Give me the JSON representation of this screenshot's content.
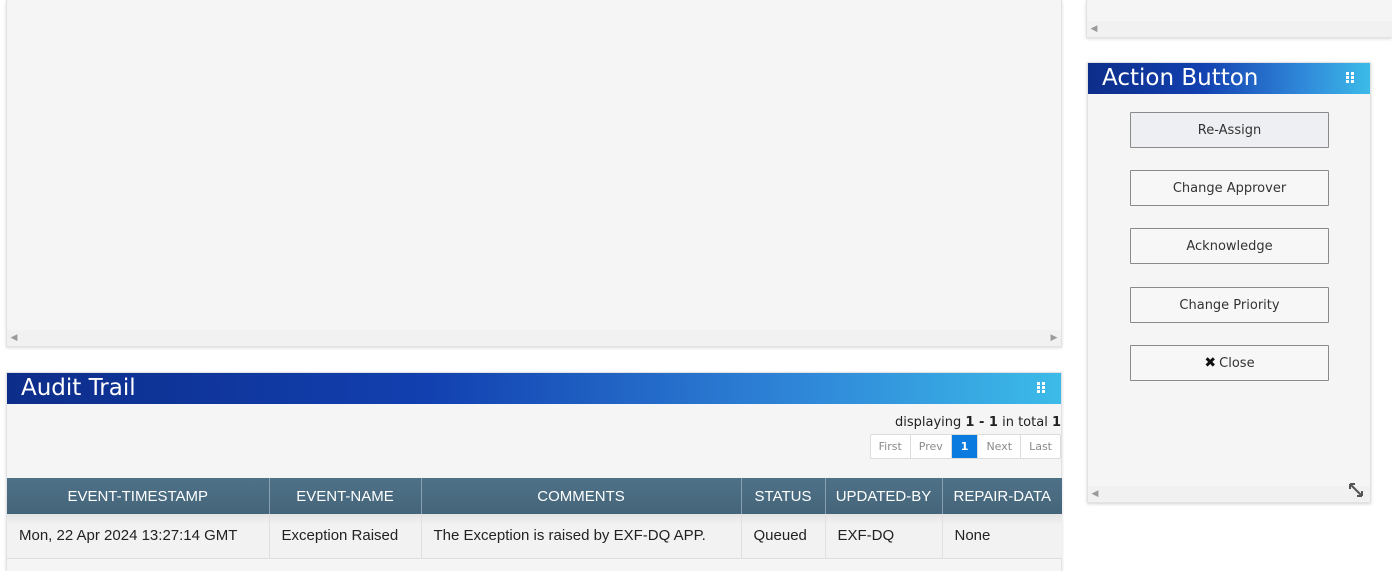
{
  "action_panel": {
    "title": "Action Button",
    "buttons": [
      {
        "label": "Re-Assign"
      },
      {
        "label": "Change Approver"
      },
      {
        "label": "Acknowledge"
      },
      {
        "label": "Change Priority"
      },
      {
        "label": "Close",
        "icon": "close-x-icon"
      }
    ]
  },
  "audit_trail": {
    "title": "Audit Trail",
    "displaying": {
      "prefix": "displaying",
      "range": "1 - 1",
      "middle": "in total",
      "total": "1"
    },
    "pager": {
      "first": "First",
      "prev": "Prev",
      "current": "1",
      "next": "Next",
      "last": "Last"
    },
    "columns": [
      "EVENT-TIMESTAMP",
      "EVENT-NAME",
      "COMMENTS",
      "STATUS",
      "UPDATED-BY",
      "REPAIR-DATA"
    ],
    "rows": [
      [
        "Mon, 22 Apr 2024 13:27:14 GMT",
        "Exception Raised",
        "The Exception is raised by EXF-DQ APP.",
        "Queued",
        "EXF-DQ",
        "None"
      ]
    ]
  },
  "colors": {
    "header_gradient_start": "#0d2d8a",
    "header_gradient_end": "#3cbbe8",
    "table_header": "#4a6b82",
    "pager_active": "#0b7be0"
  }
}
